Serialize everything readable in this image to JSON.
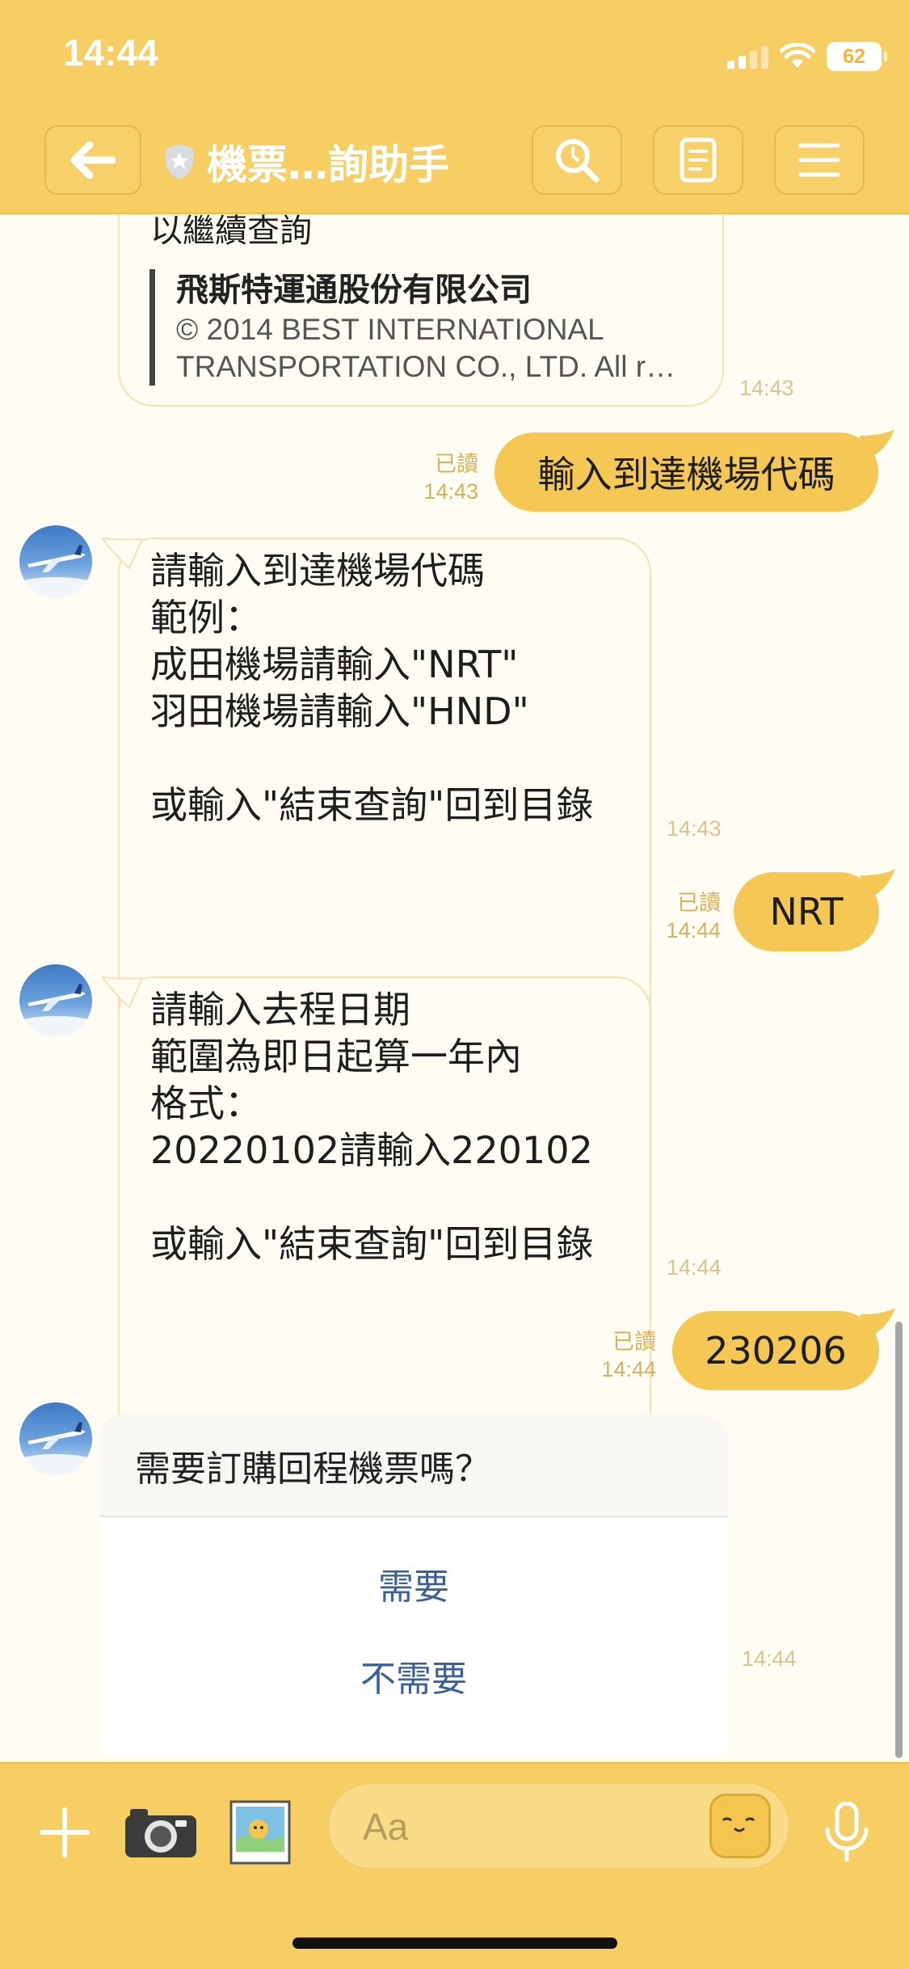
{
  "status_bar": {
    "time": "14:44",
    "battery": "62"
  },
  "header": {
    "title": "機票…詢助手"
  },
  "messages": {
    "card": {
      "partial_text": "以繼續查詢",
      "company": "飛斯特運通股份有限公司",
      "subtitle_line1": "© 2014 BEST INTERNATIONAL",
      "subtitle_line2": "TRANSPORTATION CO., LTD. All r…",
      "time": "14:43"
    },
    "out1": {
      "text": "輸入到達機場代碼",
      "read": "已讀",
      "time": "14:43"
    },
    "in1": {
      "lines": [
        "請輸入到達機場代碼",
        "範例：",
        "成田機場請輸入\"NRT\"",
        "羽田機場請輸入\"HND\"",
        "",
        "或輸入\"結束查詢\"回到目錄"
      ],
      "time": "14:43"
    },
    "out2": {
      "text": "NRT",
      "read": "已讀",
      "time": "14:44"
    },
    "in2": {
      "lines": [
        "請輸入去程日期",
        "範圍為即日起算一年內",
        "格式：",
        "20220102請輸入220102",
        "",
        "或輸入\"結束查詢\"回到目錄"
      ],
      "time": "14:44"
    },
    "out3": {
      "text": "230206",
      "read": "已讀",
      "time": "14:44"
    },
    "question": {
      "text": "需要訂購回程機票嗎？",
      "options": [
        "需要",
        "不需要"
      ],
      "time": "14:44"
    }
  },
  "input": {
    "placeholder": "Aa"
  },
  "colors": {
    "bar": "#f7ce64",
    "bubble_out": "#f5c856",
    "background": "#fffdf3",
    "link": "#3b5f9a"
  },
  "icons": [
    "back-arrow-icon",
    "shield-icon",
    "search-icon",
    "notes-icon",
    "menu-icon",
    "plus-icon",
    "camera-icon",
    "photo-icon",
    "sticker-icon",
    "microphone-icon"
  ]
}
